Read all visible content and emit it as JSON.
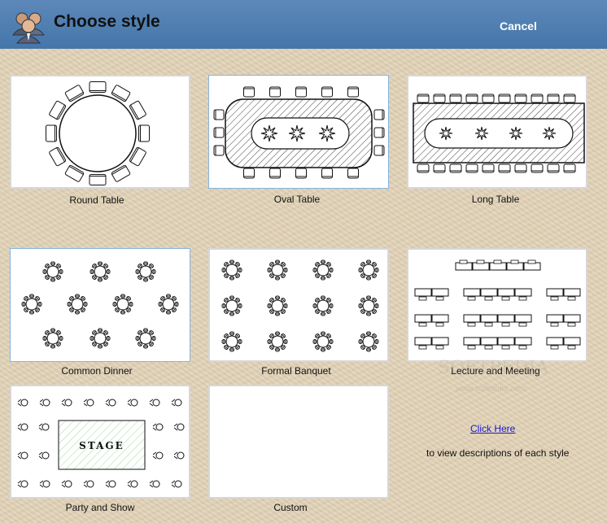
{
  "window": {
    "title": "Choose style",
    "cancel_label": "Cancel"
  },
  "styles": [
    {
      "label": "Round Table"
    },
    {
      "label": "Oval Table"
    },
    {
      "label": "Long Table"
    },
    {
      "label": "Common Dinner"
    },
    {
      "label": "Formal Banquet"
    },
    {
      "label": "Lecture and Meeting"
    },
    {
      "label": "Party and Show",
      "stage_text": "STAGE"
    },
    {
      "label": "Custom"
    }
  ],
  "watermark": {
    "main": "SOFTPEDIA",
    "sub": "www.softpedia.com"
  },
  "help": {
    "link_text": "Click Here",
    "description": "to view descriptions of each style"
  },
  "selected_styles": [
    "Oval Table",
    "Common Dinner"
  ],
  "icons": {
    "app": "users-icon"
  },
  "colors": {
    "titlebar": "#4f7fb3",
    "selected_border": "#86b3df",
    "link": "#1a1ad0"
  }
}
